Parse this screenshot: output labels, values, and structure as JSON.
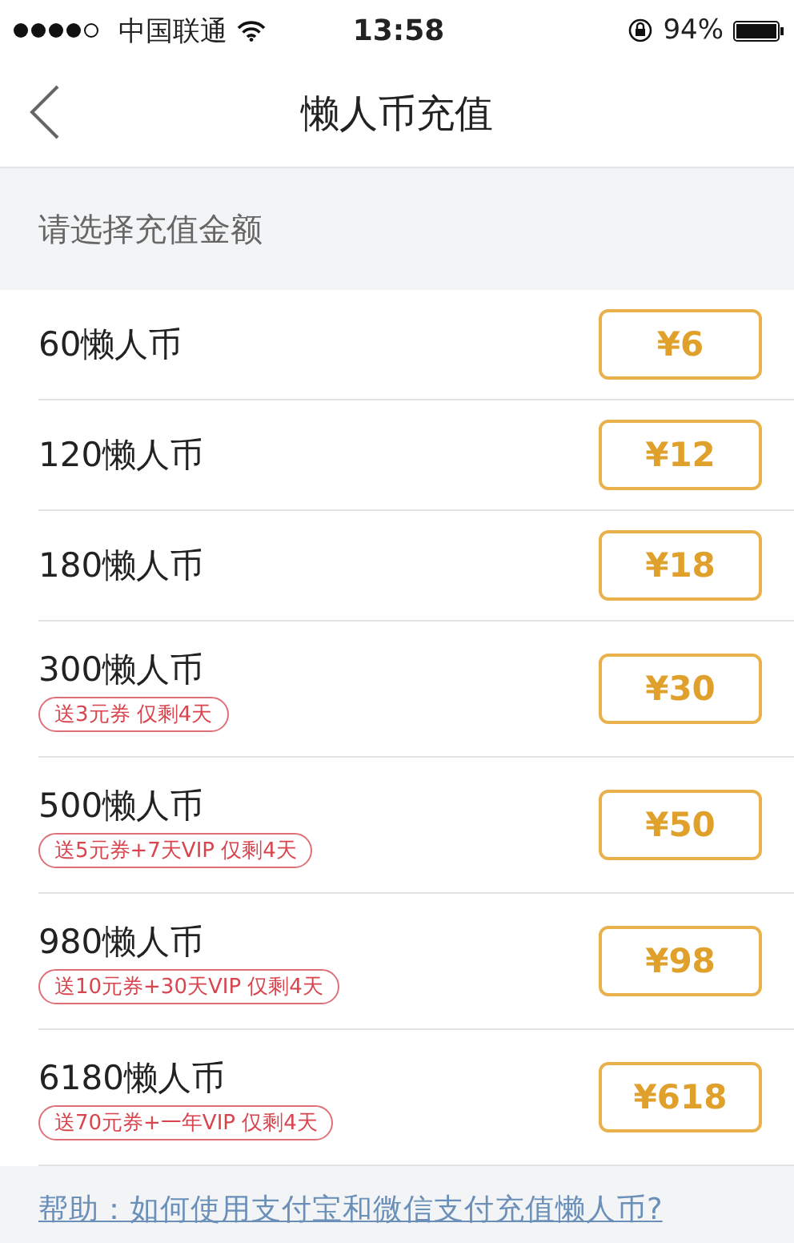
{
  "status_bar": {
    "carrier": "中国联通",
    "time": "13:58",
    "battery": "94%"
  },
  "nav": {
    "title": "懒人币充值"
  },
  "section": {
    "title": "请选择充值金额"
  },
  "options": [
    {
      "coins": "60懒人币",
      "price": "¥6"
    },
    {
      "coins": "120懒人币",
      "price": "¥12"
    },
    {
      "coins": "180懒人币",
      "price": "¥18"
    },
    {
      "coins": "300懒人币",
      "bonus": "送3元券 仅剩4天",
      "price": "¥30"
    },
    {
      "coins": "500懒人币",
      "bonus": "送5元券+7天VIP 仅剩4天",
      "price": "¥50"
    },
    {
      "coins": "980懒人币",
      "bonus": "送10元券+30天VIP 仅剩4天",
      "price": "¥98"
    },
    {
      "coins": "6180懒人币",
      "bonus": "送70元券+一年VIP 仅剩4天",
      "price": "¥618"
    }
  ],
  "help_link": "帮助：如何使用支付宝和微信支付充值懒人币?"
}
